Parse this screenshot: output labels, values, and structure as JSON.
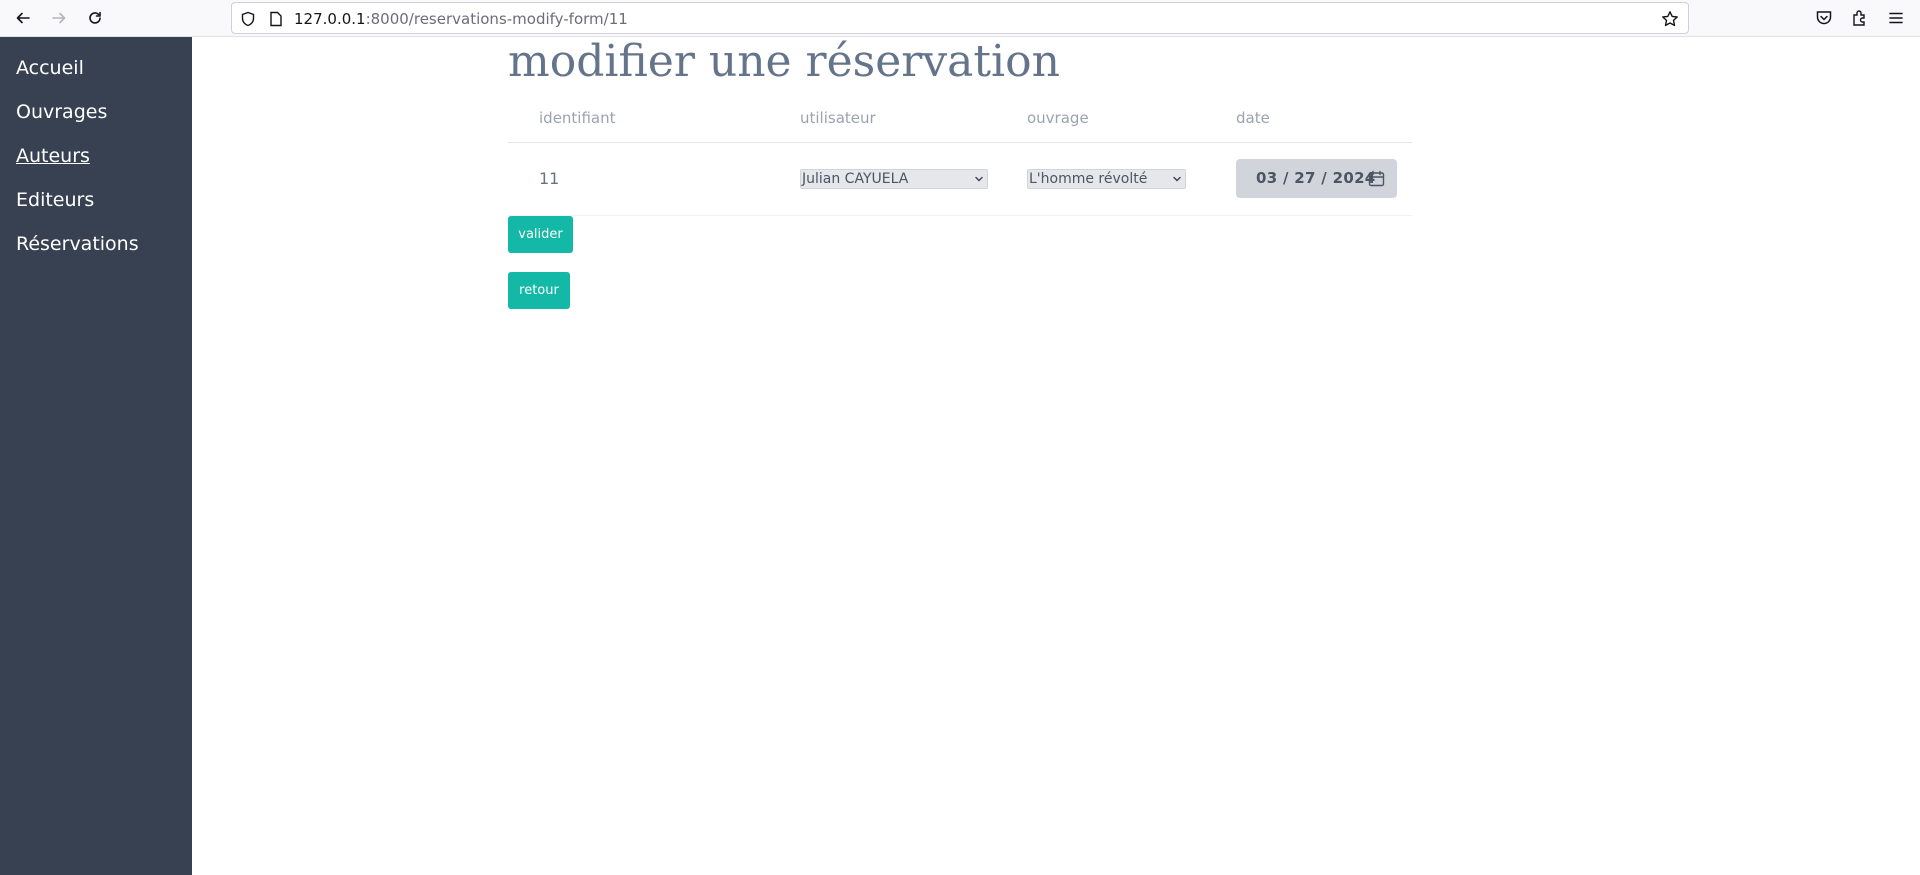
{
  "browser": {
    "url_host": "127.0.0.1",
    "url_rest": ":8000/reservations-modify-form/11"
  },
  "sidebar": {
    "items": [
      {
        "label": "Accueil"
      },
      {
        "label": "Ouvrages"
      },
      {
        "label": "Auteurs"
      },
      {
        "label": "Editeurs"
      },
      {
        "label": "Réservations"
      }
    ]
  },
  "page": {
    "title": "modifier une réservation"
  },
  "table": {
    "headers": {
      "id": "identifiant",
      "user": "utilisateur",
      "book": "ouvrage",
      "date": "date"
    },
    "row": {
      "id": "11",
      "user": "Julian CAYUELA",
      "book": "L'homme révolté",
      "date": "03 / 27 / 2024"
    }
  },
  "buttons": {
    "validate": "valider",
    "back": "retour"
  },
  "colors": {
    "sidebar_bg": "#374151",
    "button_bg": "#14b8a6",
    "title": "#64748b"
  }
}
